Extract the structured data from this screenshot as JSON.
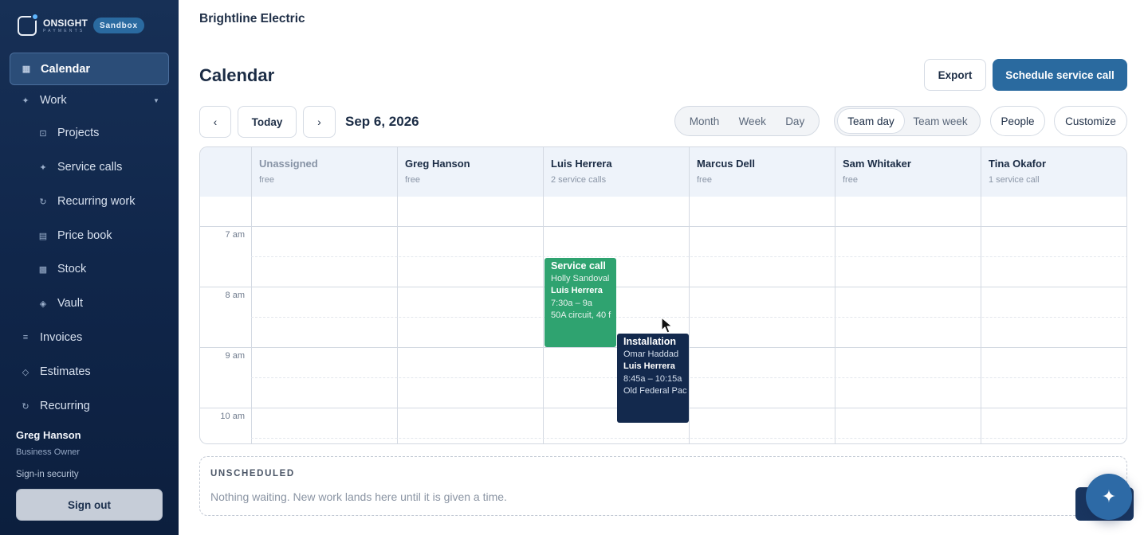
{
  "brand": {
    "name": "ONSIGHT",
    "sub": "PAYMENTS",
    "badge": "Sandbox"
  },
  "sidebar": {
    "items": [
      {
        "label": "Calendar",
        "icon": "calendar-icon"
      },
      {
        "label": "Work",
        "icon": "sparkle-icon"
      },
      {
        "label": "Projects",
        "icon": "folder-icon"
      },
      {
        "label": "Service calls",
        "icon": "sparkle-icon"
      },
      {
        "label": "Recurring work",
        "icon": "refresh-icon"
      },
      {
        "label": "Price book",
        "icon": "book-icon"
      },
      {
        "label": "Stock",
        "icon": "box-icon"
      },
      {
        "label": "Vault",
        "icon": "diamond-icon"
      },
      {
        "label": "Invoices",
        "icon": "list-icon"
      },
      {
        "label": "Estimates",
        "icon": "diamond-outline-icon"
      },
      {
        "label": "Recurring",
        "icon": "refresh-icon"
      }
    ],
    "user": {
      "name": "Greg Hanson",
      "role": "Business Owner"
    },
    "signin_security": "Sign-in security",
    "signout": "Sign out"
  },
  "header": {
    "company": "Brightline Electric",
    "title": "Calendar",
    "export": "Export",
    "schedule": "Schedule service call"
  },
  "toolbar": {
    "prev": "‹",
    "today": "Today",
    "next": "›",
    "date": "Sep 6, 2026",
    "views": [
      "Month",
      "Week",
      "Day"
    ],
    "team_views": [
      "Team day",
      "Team week"
    ],
    "team_selected": "Team day",
    "people": "People",
    "customize": "Customize"
  },
  "columns": [
    {
      "name": "Unassigned",
      "status": "free"
    },
    {
      "name": "Greg Hanson",
      "status": "free"
    },
    {
      "name": "Luis Herrera",
      "status": "2 service calls"
    },
    {
      "name": "Marcus Dell",
      "status": "free"
    },
    {
      "name": "Sam Whitaker",
      "status": "free"
    },
    {
      "name": "Tina Okafor",
      "status": "1 service call"
    }
  ],
  "times": [
    "7 am",
    "8 am",
    "9 am",
    "10 am"
  ],
  "events": [
    {
      "title": "Service call",
      "customer": "Holly Sandoval",
      "tech": "Luis Herrera",
      "time": "7:30a – 9a",
      "note": "50A circuit, 40 f",
      "color": "#2fa370"
    },
    {
      "title": "Installation",
      "customer": "Omar Haddad",
      "tech": "Luis Herrera",
      "time": "8:45a – 10:15a",
      "note": "Old Federal Pac",
      "color": "#13294d"
    }
  ],
  "unscheduled": {
    "title": "UNSCHEDULED",
    "text": "Nothing waiting. New work lands here until it is given a time."
  },
  "colors": {
    "accent": "#2a6a9f",
    "sidebar": "#10264a",
    "event_green": "#2fa370",
    "event_navy": "#13294d"
  }
}
